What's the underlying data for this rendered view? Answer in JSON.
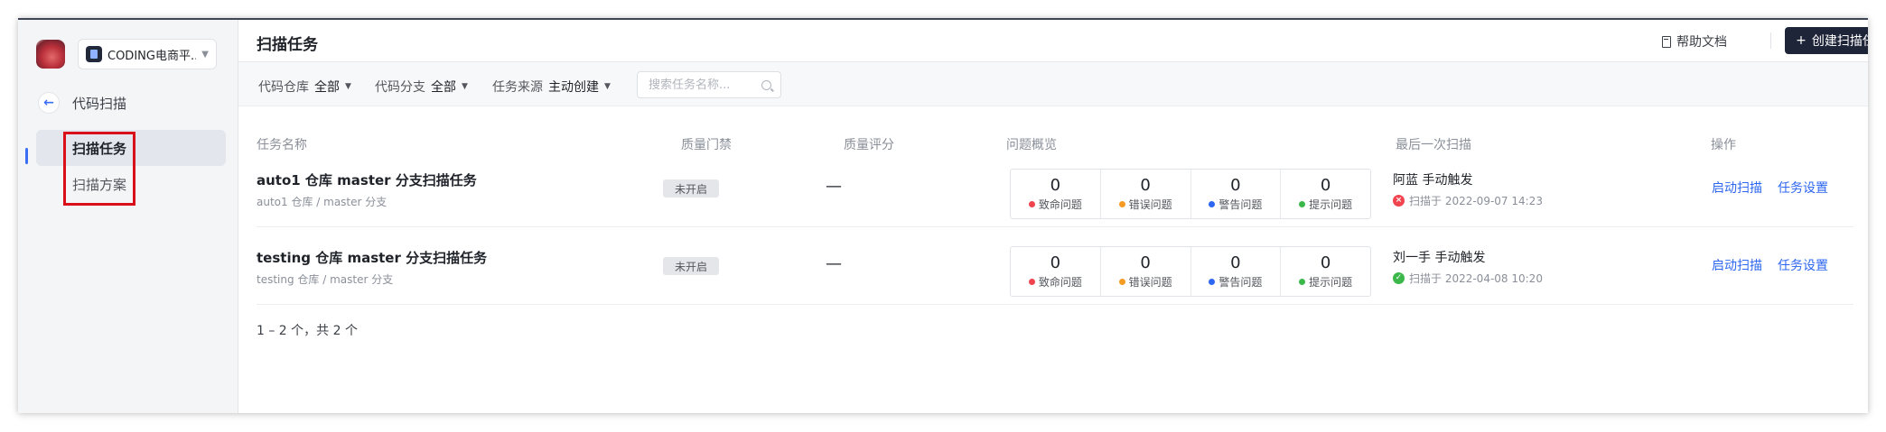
{
  "sidebar": {
    "project_name": "CODING电商平...",
    "back_label": "代码扫描",
    "nav": [
      {
        "label": "扫描任务",
        "active": true
      },
      {
        "label": "扫描方案",
        "active": false
      }
    ]
  },
  "header": {
    "title": "扫描任务",
    "help_label": "帮助文档",
    "create_label": "创建扫描任务"
  },
  "filters": [
    {
      "label": "代码仓库",
      "value": "全部"
    },
    {
      "label": "代码分支",
      "value": "全部"
    },
    {
      "label": "任务来源",
      "value": "主动创建"
    }
  ],
  "search": {
    "placeholder": "搜索任务名称..."
  },
  "columns": [
    "任务名称",
    "质量门禁",
    "质量评分",
    "问题概览",
    "最后一次扫描",
    "操作"
  ],
  "issue_types": [
    {
      "label": "致命问题",
      "color": "#f0444e"
    },
    {
      "label": "错误问题",
      "color": "#f59a23"
    },
    {
      "label": "警告问题",
      "color": "#2d66f0"
    },
    {
      "label": "提示问题",
      "color": "#3cb84a"
    }
  ],
  "rows": [
    {
      "name": "auto1 仓库 master 分支扫描任务",
      "sub": "auto1 仓库 / master 分支",
      "gate": "未开启",
      "score": "—",
      "counts": [
        "0",
        "0",
        "0",
        "0"
      ],
      "scan_by": "阿蓝 手动触发",
      "scan_time": "扫描于 2022-09-07 14:23",
      "status": "failed",
      "status_color": "#f0444e",
      "action_start": "启动扫描",
      "action_settings": "任务设置"
    },
    {
      "name": "testing 仓库 master 分支扫描任务",
      "sub": "testing 仓库 / master 分支",
      "gate": "未开启",
      "score": "—",
      "counts": [
        "0",
        "0",
        "0",
        "0"
      ],
      "scan_by": "刘一手 手动触发",
      "scan_time": "扫描于 2022-04-08 10:20",
      "status": "success",
      "status_color": "#3cb84a",
      "action_start": "启动扫描",
      "action_settings": "任务设置"
    }
  ],
  "pagination": "1 – 2 个，共 2 个"
}
